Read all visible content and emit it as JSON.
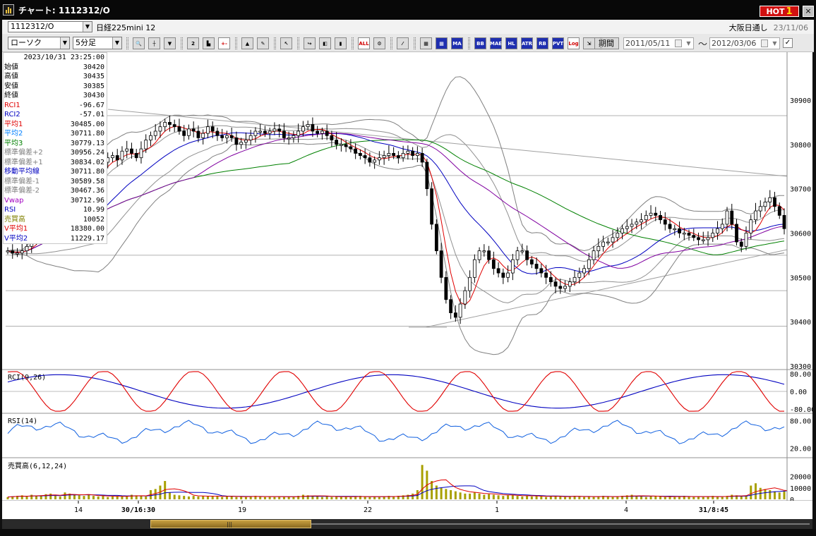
{
  "window": {
    "title": "チャート: 1112312/O",
    "hot_label": "HOT",
    "hot_num": "1",
    "close": "×"
  },
  "symbol": {
    "code": "1112312/O",
    "name": "日経225mini 12",
    "market": "大阪日通し",
    "date": "23/11/06"
  },
  "toolbar": {
    "chart_type": "ローソク",
    "interval": "5分足",
    "period_label": "期間",
    "date_from": "2011/05/11",
    "tilde": "～",
    "date_to": "2012/03/06",
    "buttons": [
      {
        "name": "zoom-icon",
        "text": "🔍",
        "style": "plain"
      },
      {
        "name": "crosshair-icon",
        "text": "┼",
        "style": "plain"
      },
      {
        "name": "candle-indicator-icon",
        "text": "▼",
        "style": "plain"
      },
      {
        "name": "magnify-2-icon",
        "text": "2",
        "style": "plain"
      },
      {
        "name": "bar-chart-icon",
        "text": "▙",
        "style": "plain"
      },
      {
        "name": "plus-minus-icon",
        "text": "+-",
        "style": "red"
      },
      {
        "name": "triangle-icon",
        "text": "▲",
        "style": "plain"
      },
      {
        "name": "pencil-icon",
        "text": "✎",
        "style": "plain"
      },
      {
        "name": "cursor-arrow-icon",
        "text": "↖",
        "style": "plain"
      },
      {
        "name": "redo-icon",
        "text": "↪",
        "style": "plain"
      },
      {
        "name": "price-marker-icon",
        "text": "◧",
        "style": "plain"
      },
      {
        "name": "candle-up-icon",
        "text": "▮",
        "style": "plain"
      },
      {
        "name": "all-icon",
        "text": "ALL",
        "style": "red"
      },
      {
        "name": "settings-icon",
        "text": "⚙",
        "style": "plain"
      },
      {
        "name": "brush-icon",
        "text": "⁄",
        "style": "plain"
      },
      {
        "name": "color-icon",
        "text": "▦",
        "style": "plain"
      },
      {
        "name": "tech-1-icon",
        "text": "▦",
        "style": "blue"
      },
      {
        "name": "ma-icon",
        "text": "MA",
        "style": "blue"
      },
      {
        "name": "bb-icon",
        "text": "BB",
        "style": "blue"
      },
      {
        "name": "mae-icon",
        "text": "MAE",
        "style": "blue"
      },
      {
        "name": "hl-icon",
        "text": "HL",
        "style": "blue"
      },
      {
        "name": "atr-icon",
        "text": "ATR",
        "style": "blue"
      },
      {
        "name": "rbo-icon",
        "text": "RB",
        "style": "blue"
      },
      {
        "name": "pvt-icon",
        "text": "PVT",
        "style": "blue"
      },
      {
        "name": "log-icon",
        "text": "Log",
        "style": "red"
      },
      {
        "name": "export-icon",
        "text": "⇲",
        "style": "plain"
      }
    ]
  },
  "info": {
    "timestamp": "2023/10/31  23:25:00",
    "rows": [
      {
        "label": "始値",
        "value": "30420",
        "color": "#000000"
      },
      {
        "label": "高値",
        "value": "30435",
        "color": "#000000"
      },
      {
        "label": "安値",
        "value": "30385",
        "color": "#000000"
      },
      {
        "label": "終値",
        "value": "30430",
        "color": "#000000"
      },
      {
        "label": "RCI1",
        "value": "-96.67",
        "color": "#e00000"
      },
      {
        "label": "RCI2",
        "value": "-57.01",
        "color": "#0000c0"
      },
      {
        "label": "平均1",
        "value": "30485.00",
        "color": "#e00000"
      },
      {
        "label": "平均2",
        "value": "30711.80",
        "color": "#0080ff"
      },
      {
        "label": "平均3",
        "value": "30779.13",
        "color": "#008000"
      },
      {
        "label": "標準偏差+2",
        "value": "30956.24",
        "color": "#808080"
      },
      {
        "label": "標準偏差+1",
        "value": "30834.02",
        "color": "#808080"
      },
      {
        "label": "移動平均線",
        "value": "30711.80",
        "color": "#0000c0"
      },
      {
        "label": "標準偏差-1",
        "value": "30589.58",
        "color": "#808080"
      },
      {
        "label": "標準偏差-2",
        "value": "30467.36",
        "color": "#808080"
      },
      {
        "label": "Vwap",
        "value": "30712.96",
        "color": "#a000c0"
      },
      {
        "label": "RSI",
        "value": "10.99",
        "color": "#0000c0"
      },
      {
        "label": "売買高",
        "value": "10052",
        "color": "#808000"
      },
      {
        "label": "V平均1",
        "value": "18380.00",
        "color": "#e00000"
      },
      {
        "label": "V平均2",
        "value": "11229.17",
        "color": "#0000c0"
      }
    ]
  },
  "chart_data": {
    "type": "candlestick",
    "price_axis": {
      "min": 30300,
      "max": 30900,
      "ticks": [
        "30900",
        "30800",
        "30700",
        "30600",
        "30500",
        "30400",
        "30300"
      ]
    },
    "rci_axis": {
      "ticks": [
        "80.00",
        "0.00",
        "-80.00"
      ]
    },
    "rsi_axis": {
      "ticks": [
        "80.00",
        "20.00"
      ]
    },
    "vol_axis": {
      "ticks": [
        "20000",
        "10000",
        "0"
      ]
    },
    "x_ticks": [
      "14",
      "30/16:30",
      "19",
      "22",
      "1",
      "4",
      "31/8:45"
    ],
    "rci_label": "RCI(9,26)",
    "rsi_label": "RSI(14)",
    "vol_label": "売買高(6,12,24)",
    "closes": [
      30560,
      30555,
      30555,
      30560,
      30570,
      30585,
      30600,
      30610,
      30625,
      30635,
      30650,
      30660,
      30675,
      30695,
      30705,
      30700,
      30715,
      30725,
      30740,
      30755,
      30760,
      30770,
      30775,
      30765,
      30785,
      30790,
      30780,
      30770,
      30790,
      30810,
      30820,
      30830,
      30840,
      30850,
      30845,
      30840,
      30830,
      30820,
      30835,
      30830,
      30815,
      30825,
      30840,
      30830,
      30820,
      30815,
      30820,
      30815,
      30800,
      30805,
      30810,
      30820,
      30830,
      30830,
      30825,
      30830,
      30835,
      30830,
      30815,
      30815,
      30820,
      30830,
      30840,
      30845,
      30830,
      30825,
      30830,
      30820,
      30810,
      30800,
      30800,
      30795,
      30790,
      30780,
      30775,
      30770,
      30760,
      30765,
      30770,
      30775,
      30780,
      30775,
      30770,
      30780,
      30785,
      30775,
      30780,
      30760,
      30700,
      30620,
      30560,
      30500,
      30450,
      30420,
      30410,
      30440,
      30470,
      30500,
      30540,
      30560,
      30560,
      30540,
      30520,
      30510,
      30500,
      30510,
      30540,
      30560,
      30560,
      30540,
      30530,
      30520,
      30510,
      30500,
      30490,
      30480,
      30475,
      30480,
      30490,
      30500,
      30510,
      30520,
      30540,
      30560,
      30570,
      30580,
      30580,
      30590,
      30600,
      30610,
      30615,
      30620,
      30625,
      30630,
      30640,
      30645,
      30640,
      30630,
      30620,
      30610,
      30610,
      30600,
      30600,
      30595,
      30590,
      30585,
      30585,
      30590,
      30600,
      30610,
      30620,
      30650,
      30620,
      30580,
      30570,
      30600,
      30630,
      30650,
      30660,
      30670,
      30680,
      30660,
      30640,
      30610
    ],
    "volume": [
      2000,
      2500,
      3000,
      3500,
      2500,
      4000,
      3000,
      3500,
      4500,
      5000,
      3000,
      2500,
      6000,
      5000,
      4000,
      3500,
      3000,
      4000,
      3000,
      2500,
      3000,
      2000,
      2500,
      3000,
      2500,
      3000,
      4000,
      3500,
      3000,
      2500,
      8000,
      9000,
      12000,
      16000,
      6000,
      4000,
      3500,
      3000,
      2500,
      3000,
      2500,
      3000,
      2500,
      3000,
      2500,
      2000,
      2500,
      3000,
      2000,
      2500,
      2000,
      2500,
      3000,
      2500,
      2000,
      2500,
      2000,
      2500,
      2000,
      2500,
      2000,
      3000,
      4000,
      3500,
      3000,
      2500,
      2000,
      2500,
      2000,
      2500,
      2000,
      2500,
      2000,
      2500,
      3000,
      2500,
      2000,
      2500,
      2000,
      2500,
      3000,
      2500,
      3000,
      3500,
      4000,
      5000,
      8000,
      30000,
      25000,
      16000,
      12000,
      10000,
      9000,
      8000,
      7000,
      6000,
      5000,
      5000,
      6000,
      5000,
      4000,
      4500,
      4000,
      3500,
      3000,
      3500,
      4000,
      3000,
      2500,
      3000,
      2500,
      3000,
      2500,
      2000,
      2500,
      3000,
      2500,
      2000,
      2500,
      3000,
      2500,
      2000,
      2500,
      2000,
      2500,
      3000,
      2500,
      2000,
      2500,
      3000,
      3500,
      4000,
      3000,
      2500,
      2000,
      2500,
      3000,
      2500,
      2000,
      2500,
      2000,
      2500,
      3000,
      2500,
      2000,
      2500,
      2000,
      2500,
      3000,
      2500,
      2000,
      3000,
      4000,
      3500,
      3000,
      3500,
      12000,
      14000,
      10000,
      9000,
      8000,
      7000,
      6000,
      7000,
      8000,
      6000,
      5000,
      4000
    ]
  }
}
